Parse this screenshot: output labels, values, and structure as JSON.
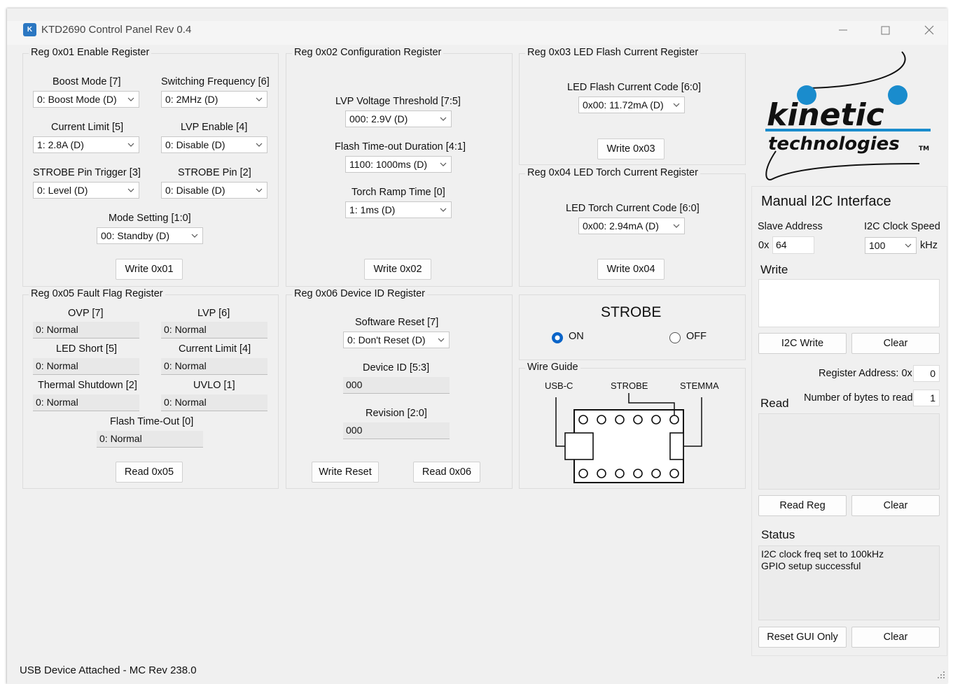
{
  "app": {
    "title": "KTD2690 Control Panel Rev 0.4",
    "icon": "kinetic-app-icon"
  },
  "reg01": {
    "title": "Reg 0x01 Enable Register",
    "boost_label": "Boost Mode [7]",
    "boost_value": "0: Boost Mode (D)",
    "freq_label": "Switching Frequency [6]",
    "freq_value": "0: 2MHz (D)",
    "ilim_label": "Current Limit [5]",
    "ilim_value": "1: 2.8A (D)",
    "lvp_label": "LVP Enable [4]",
    "lvp_value": "0: Disable (D)",
    "trig_label": "STROBE Pin Trigger [3]",
    "trig_value": "0: Level (D)",
    "strobe_label": "STROBE Pin [2]",
    "strobe_value": "0: Disable (D)",
    "mode_label": "Mode Setting [1:0]",
    "mode_value": "00: Standby (D)",
    "write_btn": "Write 0x01"
  },
  "reg02": {
    "title": "Reg 0x02 Configuration Register",
    "lvp_label": "LVP Voltage Threshold [7:5]",
    "lvp_value": "000: 2.9V (D)",
    "timeout_label": "Flash Time-out Duration [4:1]",
    "timeout_value": "1100: 1000ms (D)",
    "ramp_label": "Torch Ramp Time [0]",
    "ramp_value": "1: 1ms (D)",
    "write_btn": "Write 0x02"
  },
  "reg03": {
    "title": "Reg 0x03 LED Flash Current Register",
    "code_label": "LED Flash Current Code [6:0]",
    "code_value": "0x00: 11.72mA (D)",
    "write_btn": "Write 0x03"
  },
  "reg04": {
    "title": "Reg 0x04 LED Torch Current Register",
    "code_label": "LED Torch Current Code [6:0]",
    "code_value": "0x00: 2.94mA (D)",
    "write_btn": "Write 0x04"
  },
  "reg05": {
    "title": "Reg 0x05 Fault Flag Register",
    "ovp_label": "OVP [7]",
    "ovp_value": "0: Normal",
    "lvp_label": "LVP [6]",
    "lvp_value": "0: Normal",
    "short_label": "LED Short [5]",
    "short_value": "0: Normal",
    "ilim_label": "Current Limit [4]",
    "ilim_value": "0: Normal",
    "thermal_label": "Thermal Shutdown [2]",
    "thermal_value": "0: Normal",
    "uvlo_label": "UVLO [1]",
    "uvlo_value": "0: Normal",
    "flash_label": "Flash Time-Out [0]",
    "flash_value": "0: Normal",
    "read_btn": "Read 0x05"
  },
  "reg06": {
    "title": "Reg 0x06 Device ID Register",
    "reset_label": "Software Reset [7]",
    "reset_value": "0: Don't Reset (D)",
    "id_label": "Device ID [5:3]",
    "id_value": "000",
    "rev_label": "Revision [2:0]",
    "rev_value": "000",
    "write_reset_btn": "Write Reset",
    "read_btn": "Read 0x06"
  },
  "strobe": {
    "title": "STROBE",
    "on_label": "ON",
    "off_label": "OFF",
    "selected": "ON"
  },
  "wire_guide": {
    "title": "Wire Guide",
    "usb_label": "USB-C",
    "strobe_label": "STROBE",
    "stemma_label": "STEMMA"
  },
  "logo": {
    "word1": "kinetic",
    "word2": "technologies",
    "tm": "TM",
    "brand_blue": "#1a8ccd"
  },
  "i2c": {
    "title": "Manual I2C Interface",
    "slave_label": "Slave Address",
    "slave_prefix": "0x",
    "slave_value": "64",
    "clock_label": "I2C Clock Speed",
    "clock_value": "100",
    "clock_unit": "kHz",
    "write_label": "Write",
    "write_value": "",
    "write_btn": "I2C Write",
    "clear_btn": "Clear",
    "reg_addr_label": "Register Address: 0x",
    "reg_addr_value": "0",
    "nbytes_label": "Number of bytes to read",
    "nbytes_value": "1",
    "read_label": "Read",
    "read_value": "",
    "read_btn": "Read Reg",
    "read_clear_btn": "Clear",
    "status_label": "Status",
    "status_lines": [
      "I2C clock freq set to 100kHz",
      "GPIO setup successful"
    ],
    "reset_btn": "Reset GUI Only",
    "status_clear_btn": "Clear"
  },
  "statusbar": {
    "text": "USB Device Attached - MC Rev 238.0"
  }
}
